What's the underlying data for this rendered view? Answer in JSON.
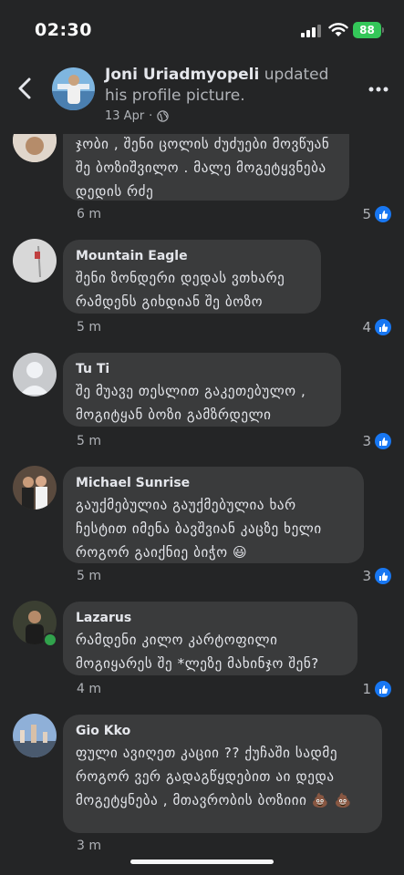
{
  "status": {
    "time": "02:30",
    "battery": "88"
  },
  "post": {
    "author": "Joni Uriadmyopeli",
    "action": " updated his profile picture.",
    "date": "13 Apr",
    "date_sep": "·"
  },
  "comments": [
    {
      "name": "",
      "text": "ჯობი , შენი ცოლის ძუძუები მოვწუან შე ბოზიშვილო . მალე მოგეტყვნება დედის რძე",
      "time": "6 m",
      "likes": "5"
    },
    {
      "name": "Mountain Eagle",
      "text": "შენი ზონდერი დედას ვთხარე რამდენს გიხდიან შე ბოზო",
      "time": "5 m",
      "likes": "4"
    },
    {
      "name": "Tu Ti",
      "text": "შე მუავე თესლით გაკეთებულო , მოგიტყან ბოზი გამზრდელი",
      "time": "5 m",
      "likes": "3"
    },
    {
      "name": "Michael Sunrise",
      "text": "გაუქმებულია გაუქმებულია ხარ ჩესტით იმენა ბავშვიან კაცზე ხელი როგორ გაიქნიე ბიჭო 😃",
      "time": "5 m",
      "likes": "3"
    },
    {
      "name": "Lazarus",
      "text": "რამდენი კილო კარტოფილი მოგიყარეს შე *ლეზე მახინჯო შენ?",
      "time": "4 m",
      "likes": "1"
    },
    {
      "name": "Gio Kko",
      "text": "ფული ავიღეთ კაციი ?? ქუჩაში სადმე როგორ ვერ გადაგწყდებით აი დედა მოგეტყნება , მთავრობის ბოზიიი 💩 💩",
      "time": "3 m",
      "likes": ""
    }
  ]
}
